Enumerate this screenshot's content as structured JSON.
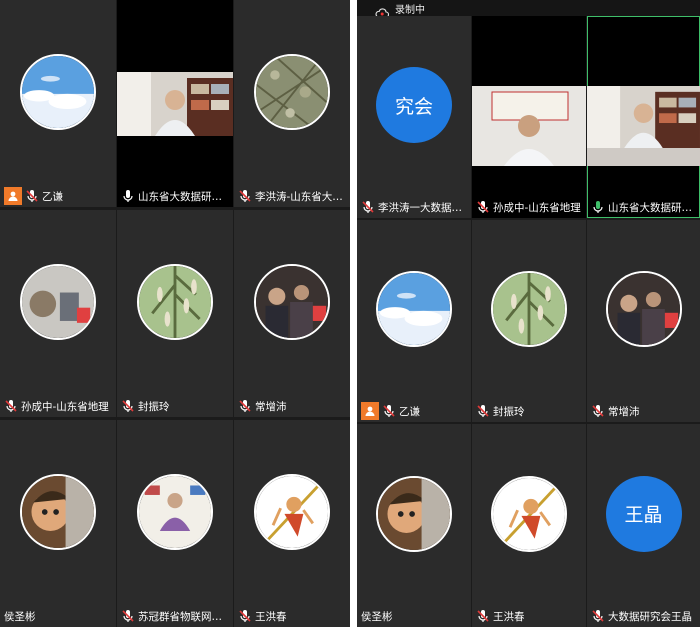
{
  "status": {
    "recording_label": "录制中"
  },
  "left_panel": {
    "tiles": [
      {
        "name": "乙谦",
        "host": true,
        "mic": "muted",
        "avatar": "sky"
      },
      {
        "name": "山东省大数据研究会",
        "mic": "on",
        "avatar": "video"
      },
      {
        "name": "李洪涛-山东省大数据",
        "mic": "muted",
        "avatar": "branches"
      },
      {
        "name": "孙成中-山东省地理",
        "mic": "muted",
        "avatar": "cafe"
      },
      {
        "name": "封振玲",
        "mic": "muted",
        "avatar": "tree"
      },
      {
        "name": "常增沛",
        "mic": "muted",
        "avatar": "group"
      },
      {
        "name": "侯圣彬",
        "mic": "none",
        "avatar": "comic"
      },
      {
        "name": "苏冠群省物联网协会",
        "mic": "muted",
        "avatar": "meditate"
      },
      {
        "name": "王洪春",
        "mic": "muted",
        "avatar": "monkey"
      }
    ]
  },
  "right_panel": {
    "tiles": [
      {
        "name": "李洪涛一大数据研究会",
        "mic": "muted",
        "avatar": "text",
        "avatar_text": "究会",
        "avatar_color": "#1f7ae0"
      },
      {
        "name": "孙成中-山东省地理",
        "mic": "muted",
        "avatar": "video2"
      },
      {
        "name": "山东省大数据研究会",
        "mic": "speaking",
        "avatar": "video",
        "active": true
      },
      {
        "name": "乙谦",
        "host": true,
        "mic": "muted",
        "avatar": "sky"
      },
      {
        "name": "封振玲",
        "mic": "muted",
        "avatar": "tree"
      },
      {
        "name": "常增沛",
        "mic": "muted",
        "avatar": "group"
      },
      {
        "name": "侯圣彬",
        "mic": "none",
        "avatar": "comic"
      },
      {
        "name": "王洪春",
        "mic": "muted",
        "avatar": "monkey"
      },
      {
        "name": "大数据研究会王晶",
        "mic": "muted",
        "avatar": "text",
        "avatar_text": "王晶",
        "avatar_color": "#1f7ae0"
      }
    ]
  }
}
